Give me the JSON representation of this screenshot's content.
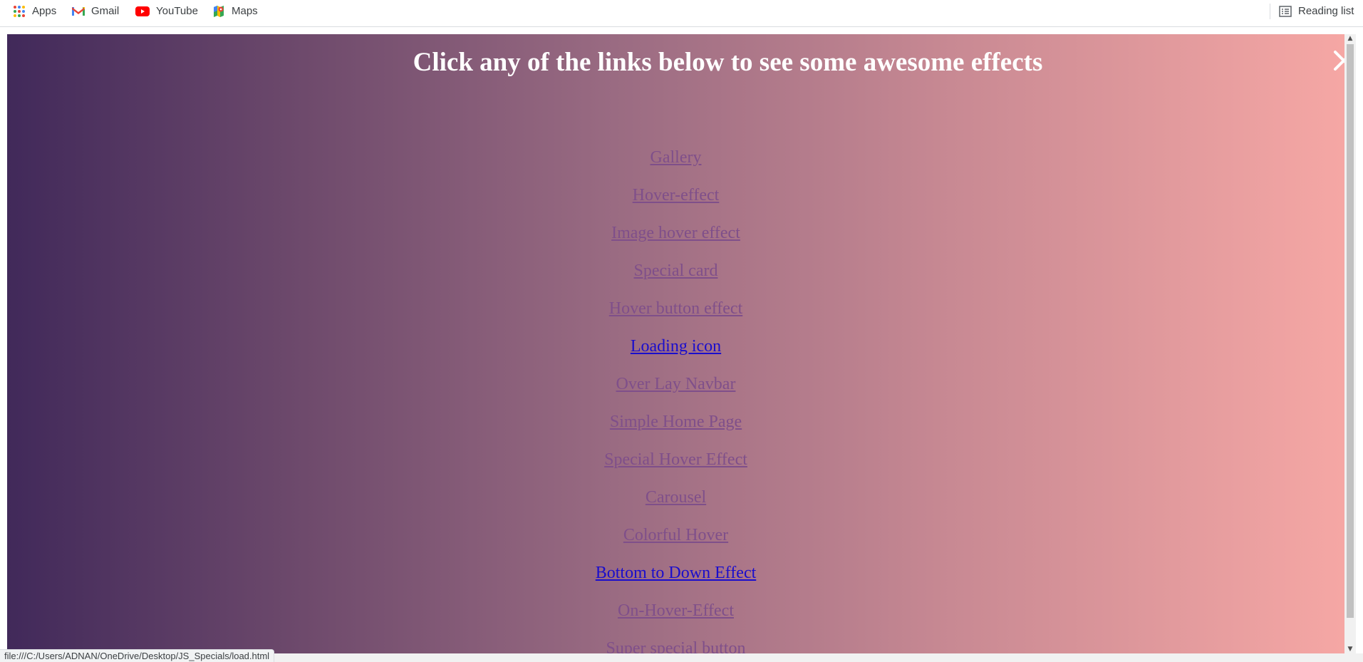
{
  "bookmarks": {
    "apps": "Apps",
    "gmail": "Gmail",
    "youtube": "YouTube",
    "maps": "Maps",
    "reading_list": "Reading list"
  },
  "page": {
    "heading": "Click any of the links below to see some awesome effects",
    "links": [
      "Gallery",
      "Hover-effect",
      "Image hover effect",
      "Special card",
      "Hover button effect",
      "Loading icon",
      "Over Lay Navbar",
      "Simple Home Page",
      "Special Hover Effect",
      "Carousel",
      "Colorful Hover",
      "Bottom to Down Effect",
      "On-Hover-Effect",
      "Super special button"
    ]
  },
  "status_bar": {
    "url": "file:///C:/Users/ADNAN/OneDrive/Desktop/JS_Specials/load.html"
  },
  "colors": {
    "gradient_start": "#41295a",
    "gradient_end": "#f7a8a5",
    "visited_link": "#7f4f8a",
    "unvisited_link": "#1a0dcc"
  },
  "icons": [
    "apps-grid-icon",
    "gmail-icon",
    "youtube-icon",
    "maps-icon",
    "reading-list-icon",
    "close-icon"
  ]
}
